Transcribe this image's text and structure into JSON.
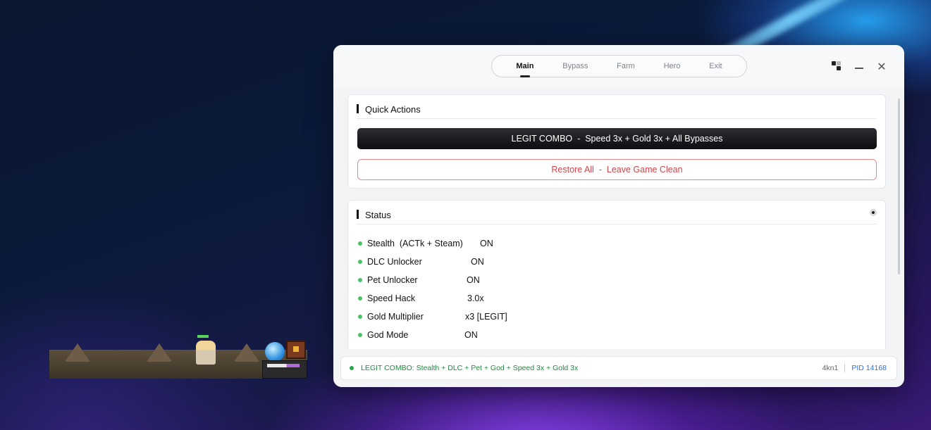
{
  "colors": {
    "accent_dark": "#111111",
    "danger": "#d0454d",
    "status_on": "#4cc267",
    "footer_text": "#1f8a3f",
    "pid": "#2f6fd6"
  },
  "window": {
    "tabs": [
      {
        "label": "Main",
        "active": true
      },
      {
        "label": "Bypass",
        "active": false
      },
      {
        "label": "Farm",
        "active": false
      },
      {
        "label": "Hero",
        "active": false
      },
      {
        "label": "Exit",
        "active": false
      }
    ],
    "controls": {
      "theme_icon": "theme-toggle-icon",
      "minimize_icon": "minimize-icon",
      "close_icon": "close-icon"
    }
  },
  "quick_actions": {
    "title": "Quick Actions",
    "combo_button": "LEGIT COMBO  -  Speed 3x + Gold 3x + All Bypasses",
    "restore_button": "Restore All  -  Leave Game Clean"
  },
  "status": {
    "title": "Status",
    "rows": [
      {
        "label": "Stealth  (ACTk + Steam)",
        "value": "ON"
      },
      {
        "label": "DLC Unlocker",
        "value": "ON"
      },
      {
        "label": "Pet Unlocker",
        "value": "ON"
      },
      {
        "label": "Speed Hack",
        "value": "3.0x"
      },
      {
        "label": "Gold Multiplier",
        "value": "x3 [LEGIT]"
      },
      {
        "label": "God Mode",
        "value": "ON"
      }
    ]
  },
  "footer": {
    "message": "LEGIT COMBO: Stealth + DLC + Pet + God + Speed 3x + Gold 3x",
    "user": "4kn1",
    "pid": "PID 14168"
  }
}
